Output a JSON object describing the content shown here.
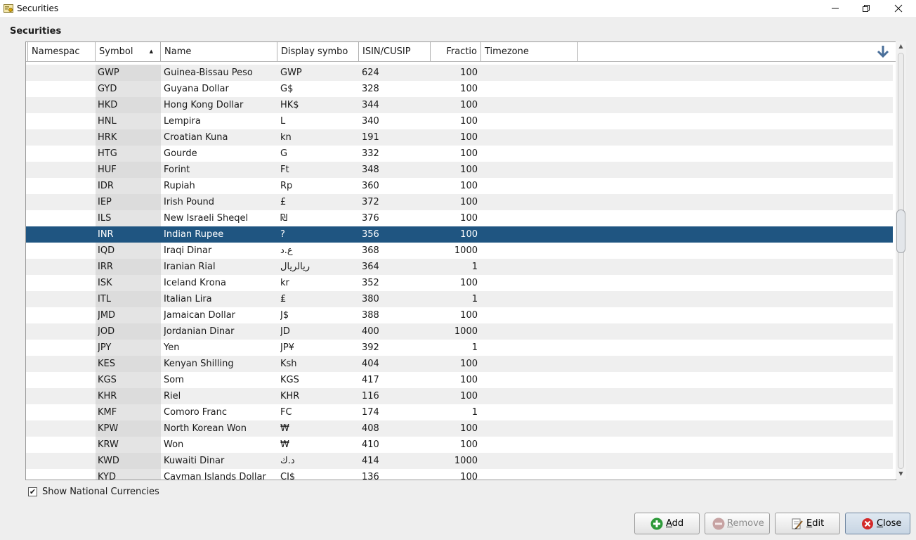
{
  "window": {
    "title": "Securities",
    "controls": [
      "minimize",
      "restore",
      "close"
    ]
  },
  "section_label": "Securities",
  "table": {
    "columns": [
      {
        "label": "Namespac"
      },
      {
        "label": "Symbol",
        "sorted": "ascending"
      },
      {
        "label": "Name"
      },
      {
        "label": "Display symbo"
      },
      {
        "label": "ISIN/CUSIP"
      },
      {
        "label": "Fractio"
      },
      {
        "label": "Timezone"
      }
    ],
    "selected_symbol": "INR",
    "rows": [
      {
        "symbol": "GWP",
        "name": "Guinea-Bissau Peso",
        "display": "GWP",
        "isin": "624",
        "fraction": "100"
      },
      {
        "symbol": "GYD",
        "name": "Guyana Dollar",
        "display": "G$",
        "isin": "328",
        "fraction": "100"
      },
      {
        "symbol": "HKD",
        "name": "Hong Kong Dollar",
        "display": "HK$",
        "isin": "344",
        "fraction": "100"
      },
      {
        "symbol": "HNL",
        "name": "Lempira",
        "display": "L",
        "isin": "340",
        "fraction": "100"
      },
      {
        "symbol": "HRK",
        "name": "Croatian Kuna",
        "display": "kn",
        "isin": "191",
        "fraction": "100"
      },
      {
        "symbol": "HTG",
        "name": "Gourde",
        "display": "G",
        "isin": "332",
        "fraction": "100"
      },
      {
        "symbol": "HUF",
        "name": "Forint",
        "display": "Ft",
        "isin": "348",
        "fraction": "100"
      },
      {
        "symbol": "IDR",
        "name": "Rupiah",
        "display": "Rp",
        "isin": "360",
        "fraction": "100"
      },
      {
        "symbol": "IEP",
        "name": "Irish Pound",
        "display": "£",
        "isin": "372",
        "fraction": "100"
      },
      {
        "symbol": "ILS",
        "name": "New Israeli Sheqel",
        "display": "₪",
        "isin": "376",
        "fraction": "100"
      },
      {
        "symbol": "INR",
        "name": "Indian Rupee",
        "display": "?",
        "isin": "356",
        "fraction": "100"
      },
      {
        "symbol": "IQD",
        "name": "Iraqi Dinar",
        "display": "ع.د",
        "isin": "368",
        "fraction": "1000"
      },
      {
        "symbol": "IRR",
        "name": "Iranian Rial",
        "display": "ریالریال",
        "isin": "364",
        "fraction": "1"
      },
      {
        "symbol": "ISK",
        "name": "Iceland Krona",
        "display": "kr",
        "isin": "352",
        "fraction": "100"
      },
      {
        "symbol": "ITL",
        "name": "Italian Lira",
        "display": "₤",
        "isin": "380",
        "fraction": "1"
      },
      {
        "symbol": "JMD",
        "name": "Jamaican Dollar",
        "display": "J$",
        "isin": "388",
        "fraction": "100"
      },
      {
        "symbol": "JOD",
        "name": "Jordanian Dinar",
        "display": "JD",
        "isin": "400",
        "fraction": "1000"
      },
      {
        "symbol": "JPY",
        "name": "Yen",
        "display": "JP¥",
        "isin": "392",
        "fraction": "1"
      },
      {
        "symbol": "KES",
        "name": "Kenyan Shilling",
        "display": "Ksh",
        "isin": "404",
        "fraction": "100"
      },
      {
        "symbol": "KGS",
        "name": "Som",
        "display": "KGS",
        "isin": "417",
        "fraction": "100"
      },
      {
        "symbol": "KHR",
        "name": "Riel",
        "display": "KHR",
        "isin": "116",
        "fraction": "100"
      },
      {
        "symbol": "KMF",
        "name": "Comoro Franc",
        "display": "FC",
        "isin": "174",
        "fraction": "1"
      },
      {
        "symbol": "KPW",
        "name": "North Korean Won",
        "display": "₩",
        "isin": "408",
        "fraction": "100"
      },
      {
        "symbol": "KRW",
        "name": "Won",
        "display": "₩",
        "isin": "410",
        "fraction": "100"
      },
      {
        "symbol": "KWD",
        "name": "Kuwaiti Dinar",
        "display": "د.ك",
        "isin": "414",
        "fraction": "1000"
      },
      {
        "symbol": "KYD",
        "name": "Cayman Islands Dollar",
        "display": "CI$",
        "isin": "136",
        "fraction": "100"
      }
    ]
  },
  "scrollbar": {
    "position_fraction": 0.42
  },
  "show_national_currencies": {
    "label": "Show National Currencies",
    "checked": true
  },
  "buttons": {
    "add": {
      "label": "Add",
      "mnemonic": "A",
      "rest": "dd",
      "icon": "add-icon"
    },
    "remove": {
      "label": "Remove",
      "mnemonic": "R",
      "rest": "emove",
      "icon": "remove-icon",
      "disabled": true
    },
    "edit": {
      "label": "Edit",
      "mnemonic": "E",
      "rest": "dit",
      "icon": "edit-icon"
    },
    "close": {
      "label": "Close",
      "mnemonic": "C",
      "rest": "lose",
      "icon": "close-icon"
    }
  },
  "colors": {
    "selection": "#1f5581",
    "add_green": "#2e9a3a",
    "close_red": "#d32a2a"
  }
}
